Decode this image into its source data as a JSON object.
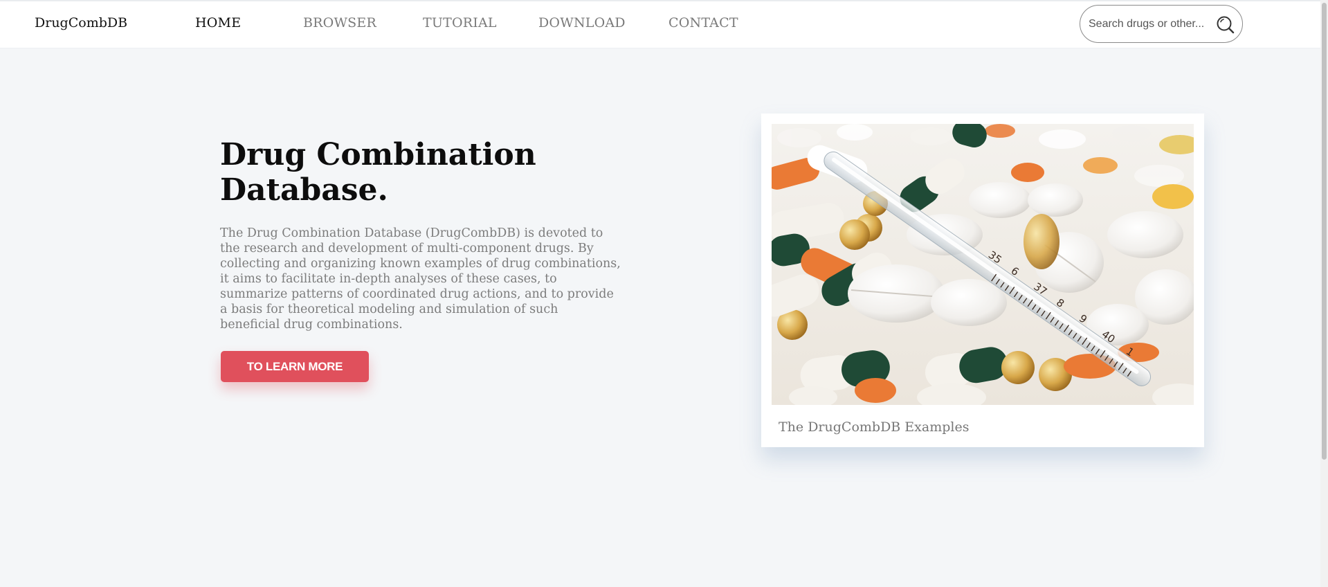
{
  "nav": {
    "brand": "DrugCombDB",
    "links": [
      {
        "label": "HOME",
        "active": true
      },
      {
        "label": "BROWSER",
        "active": false
      },
      {
        "label": "TUTORIAL",
        "active": false
      },
      {
        "label": "DOWNLOAD",
        "active": false
      },
      {
        "label": "CONTACT",
        "active": false
      }
    ],
    "search": {
      "placeholder": "Search drugs or other...",
      "value": "",
      "icon": "search-icon"
    }
  },
  "hero": {
    "title": "Drug Combination Database.",
    "description": "The Drug Combination Database (DrugCombDB) is devoted to the research and development of multi-component drugs. By collecting and organizing known examples of drug combinations, it aims to facilitate in-depth analyses of these cases, to summarize patterns of coordinated drug actions, and to provide a basis for theoretical modeling and simulation of such beneficial drug combinations.",
    "cta_label": "TO LEARN MORE"
  },
  "card": {
    "image": {
      "icon": "pills-thermometer-photo",
      "thermometer_numbers": [
        "35",
        "6",
        "37",
        "8",
        "9",
        "40",
        "1"
      ]
    },
    "caption": "The DrugCombDB Examples"
  },
  "colors": {
    "accent": "#e0505c",
    "background": "#f4f6f8",
    "nav_active": "#111111",
    "nav_inactive": "#7a7a7a"
  }
}
